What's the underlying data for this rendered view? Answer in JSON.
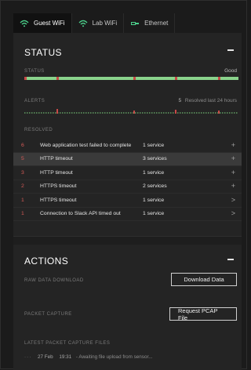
{
  "tabs": [
    {
      "label": "Guest WiFi",
      "active": true,
      "icon": "wifi-icon"
    },
    {
      "label": "Lab WiFi",
      "active": false,
      "icon": "wifi-icon"
    },
    {
      "label": "Ethernet",
      "active": false,
      "icon": "ethernet-icon"
    }
  ],
  "status": {
    "title": "STATUS",
    "status_label": "STATUS",
    "status_value": "Good",
    "alerts_label": "ALERTS",
    "alerts_count": "5",
    "alerts_suffix": "Resolved last 24 hours",
    "resolved_label": "RESOLVED",
    "resolved": [
      {
        "num": "6",
        "message": "Web application test failed to complete",
        "services": "1 service",
        "action": "+",
        "selected": false
      },
      {
        "num": "5",
        "message": "HTTP timeout",
        "services": "3 services",
        "action": "+",
        "selected": true
      },
      {
        "num": "3",
        "message": "HTTP timeout",
        "services": "1 service",
        "action": "+",
        "selected": false
      },
      {
        "num": "2",
        "message": "HTTPS timeout",
        "services": "2 services",
        "action": "+",
        "selected": false
      },
      {
        "num": "1",
        "message": "HTTPS timeout",
        "services": "1 service",
        "action": ">",
        "selected": false
      },
      {
        "num": "1",
        "message": "Connection to Slack API timed out",
        "services": "1 service",
        "action": ">",
        "selected": false
      }
    ]
  },
  "actions": {
    "title": "ACTIONS",
    "raw_label": "RAW DATA DOWNLOAD",
    "download_btn": "Download Data",
    "pcap_label": "PACKET CAPTURE",
    "pcap_btn": "Request PCAP File",
    "files_label": "LATEST PACKET CAPTURE FILES",
    "file": {
      "dots": "···",
      "date": "27 Feb",
      "time": "19:31",
      "status": "- Awaiting file upload from sensor..."
    }
  },
  "colors": {
    "good": "#8ad38c",
    "alert": "#c74a48"
  }
}
